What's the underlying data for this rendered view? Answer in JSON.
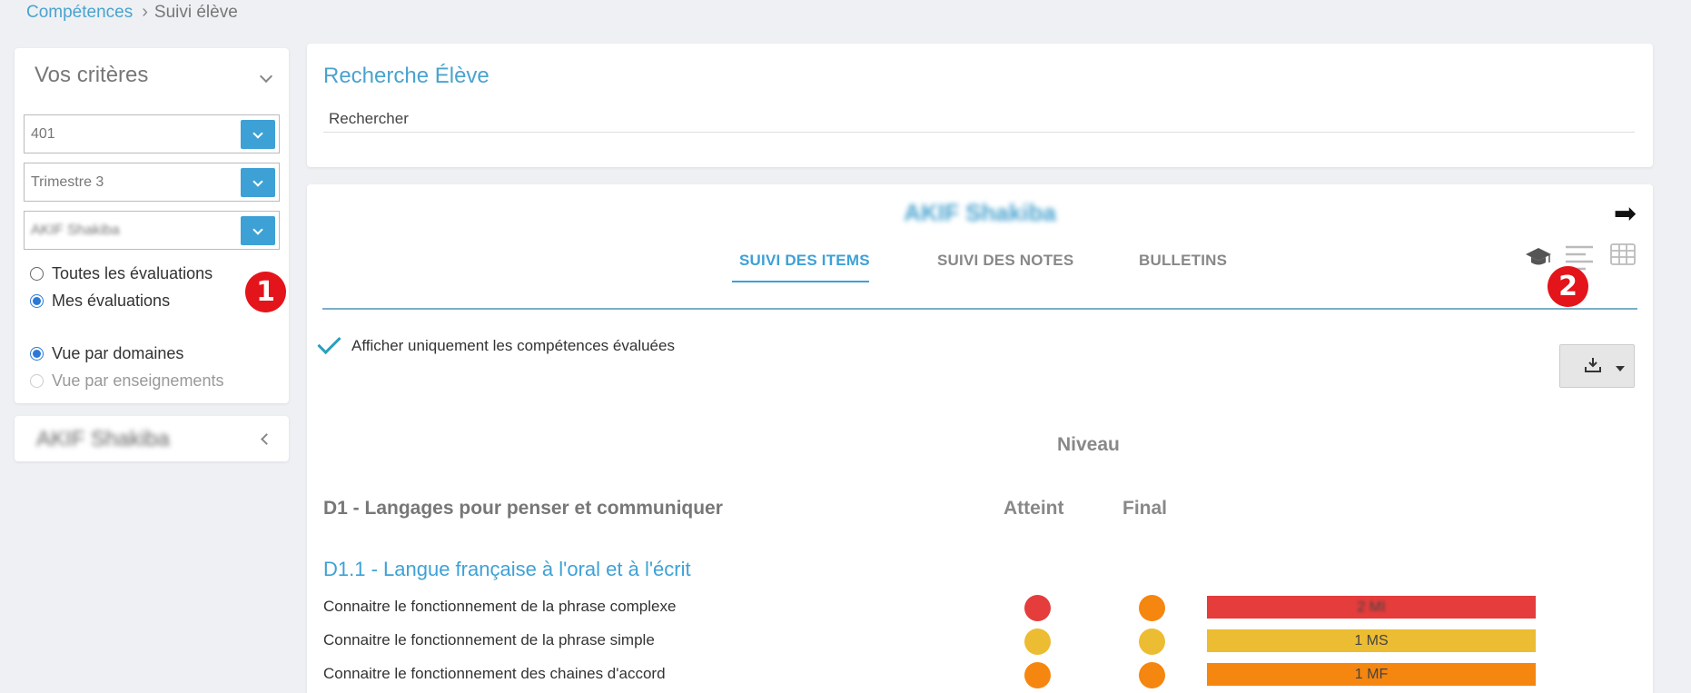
{
  "breadcrumb": {
    "parent": "Compétences",
    "separator": "›",
    "current": "Suivi élève"
  },
  "criteria": {
    "title": "Vos critères",
    "selects": [
      {
        "value": "401"
      },
      {
        "value": "Trimestre 3"
      },
      {
        "value": "AKIF Shakiba"
      }
    ],
    "eval_options": [
      {
        "label": "Toutes les évaluations",
        "checked": false
      },
      {
        "label": "Mes évaluations",
        "checked": true
      }
    ],
    "view_options": [
      {
        "label": "Vue par domaines",
        "checked": true
      },
      {
        "label": "Vue par enseignements",
        "checked": false,
        "disabled": true
      }
    ]
  },
  "student_panel": {
    "name": "AKIF Shakiba"
  },
  "badges": {
    "one": "1",
    "two": "2"
  },
  "search": {
    "title": "Recherche Élève",
    "placeholder": "Rechercher"
  },
  "main": {
    "student_name": "AKIF Shakiba",
    "next_arrow": "➡",
    "tabs": [
      {
        "label": "SUIVI DES ITEMS",
        "active": true
      },
      {
        "label": "SUIVI DES NOTES",
        "active": false
      },
      {
        "label": "BULLETINS",
        "active": false
      }
    ],
    "view_icons": [
      "graduation-cap-icon",
      "text-lines-icon",
      "table-grid-icon"
    ],
    "filter_label": "Afficher uniquement les compétences évaluées",
    "niveau_header": "Niveau",
    "domain_title": "D1 - Langages pour penser et communiquer",
    "col_atteint": "Atteint",
    "col_final": "Final",
    "subdomain_title": "D1.1 - Langue française à l'oral et à l'écrit",
    "skills": [
      {
        "label": "Connaitre le fonctionnement de la phrase complexe",
        "atteint_color": "#e53c3c",
        "final_color": "#f5860f",
        "bar_label": "2 MI",
        "bar_color": "#e53c3c"
      },
      {
        "label": "Connaitre le fonctionnement de la phrase simple",
        "atteint_color": "#ecbc32",
        "final_color": "#ecbc32",
        "bar_label": "1 MS",
        "bar_color": "#ecbc32"
      },
      {
        "label": "Connaitre le fonctionnement des chaines d'accord",
        "atteint_color": "#f5860f",
        "final_color": "#f5860f",
        "bar_label": "1 MF",
        "bar_color": "#f5860f"
      }
    ]
  }
}
